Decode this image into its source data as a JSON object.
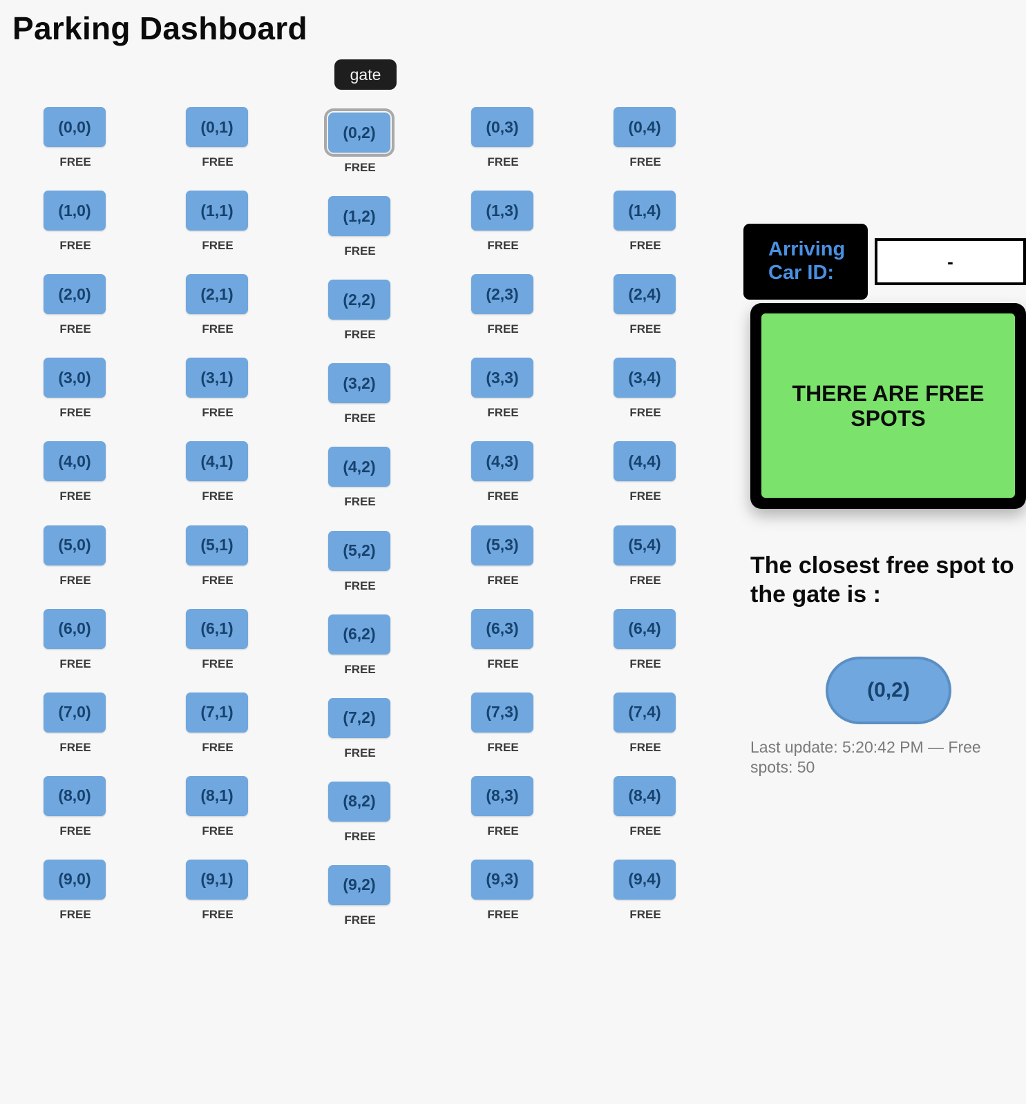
{
  "page_title": "Parking Dashboard",
  "gate_label": "gate",
  "grid": {
    "rows": 10,
    "cols": 5,
    "highlighted_spot": "(0,2)",
    "spots": [
      {
        "id": "(0,0)",
        "status": "FREE"
      },
      {
        "id": "(0,1)",
        "status": "FREE"
      },
      {
        "id": "(0,2)",
        "status": "FREE"
      },
      {
        "id": "(0,3)",
        "status": "FREE"
      },
      {
        "id": "(0,4)",
        "status": "FREE"
      },
      {
        "id": "(1,0)",
        "status": "FREE"
      },
      {
        "id": "(1,1)",
        "status": "FREE"
      },
      {
        "id": "(1,2)",
        "status": "FREE"
      },
      {
        "id": "(1,3)",
        "status": "FREE"
      },
      {
        "id": "(1,4)",
        "status": "FREE"
      },
      {
        "id": "(2,0)",
        "status": "FREE"
      },
      {
        "id": "(2,1)",
        "status": "FREE"
      },
      {
        "id": "(2,2)",
        "status": "FREE"
      },
      {
        "id": "(2,3)",
        "status": "FREE"
      },
      {
        "id": "(2,4)",
        "status": "FREE"
      },
      {
        "id": "(3,0)",
        "status": "FREE"
      },
      {
        "id": "(3,1)",
        "status": "FREE"
      },
      {
        "id": "(3,2)",
        "status": "FREE"
      },
      {
        "id": "(3,3)",
        "status": "FREE"
      },
      {
        "id": "(3,4)",
        "status": "FREE"
      },
      {
        "id": "(4,0)",
        "status": "FREE"
      },
      {
        "id": "(4,1)",
        "status": "FREE"
      },
      {
        "id": "(4,2)",
        "status": "FREE"
      },
      {
        "id": "(4,3)",
        "status": "FREE"
      },
      {
        "id": "(4,4)",
        "status": "FREE"
      },
      {
        "id": "(5,0)",
        "status": "FREE"
      },
      {
        "id": "(5,1)",
        "status": "FREE"
      },
      {
        "id": "(5,2)",
        "status": "FREE"
      },
      {
        "id": "(5,3)",
        "status": "FREE"
      },
      {
        "id": "(5,4)",
        "status": "FREE"
      },
      {
        "id": "(6,0)",
        "status": "FREE"
      },
      {
        "id": "(6,1)",
        "status": "FREE"
      },
      {
        "id": "(6,2)",
        "status": "FREE"
      },
      {
        "id": "(6,3)",
        "status": "FREE"
      },
      {
        "id": "(6,4)",
        "status": "FREE"
      },
      {
        "id": "(7,0)",
        "status": "FREE"
      },
      {
        "id": "(7,1)",
        "status": "FREE"
      },
      {
        "id": "(7,2)",
        "status": "FREE"
      },
      {
        "id": "(7,3)",
        "status": "FREE"
      },
      {
        "id": "(7,4)",
        "status": "FREE"
      },
      {
        "id": "(8,0)",
        "status": "FREE"
      },
      {
        "id": "(8,1)",
        "status": "FREE"
      },
      {
        "id": "(8,2)",
        "status": "FREE"
      },
      {
        "id": "(8,3)",
        "status": "FREE"
      },
      {
        "id": "(8,4)",
        "status": "FREE"
      },
      {
        "id": "(9,0)",
        "status": "FREE"
      },
      {
        "id": "(9,1)",
        "status": "FREE"
      },
      {
        "id": "(9,2)",
        "status": "FREE"
      },
      {
        "id": "(9,3)",
        "status": "FREE"
      },
      {
        "id": "(9,4)",
        "status": "FREE"
      }
    ]
  },
  "arriving": {
    "label": "Arriving Car ID:",
    "value": "-"
  },
  "status_panel": {
    "message": "THERE ARE FREE SPOTS"
  },
  "closest": {
    "heading": "The closest free spot to the gate is :",
    "spot": "(0,2)"
  },
  "last_update": "Last update: 5:20:42 PM — Free spots: 50",
  "colors": {
    "spot_fill": "#6fa7de",
    "spot_text": "#17426e",
    "status_ok": "#7be36b",
    "label_accent": "#4a90e2",
    "background": "#f7f7f7"
  }
}
